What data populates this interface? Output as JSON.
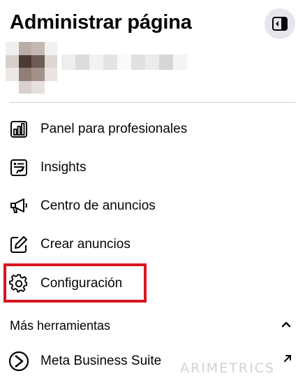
{
  "header": {
    "title": "Administrar página",
    "collapse_icon": "sidebar-collapse-icon"
  },
  "profile": {
    "avatar_blurred": true,
    "name_blurred": true
  },
  "menu": {
    "items": [
      {
        "label": "Panel para profesionales",
        "icon": "dashboard-chart-icon"
      },
      {
        "label": "Insights",
        "icon": "insights-report-icon"
      },
      {
        "label": "Centro de anuncios",
        "icon": "megaphone-icon"
      },
      {
        "label": "Crear anuncios",
        "icon": "edit-pencil-icon"
      },
      {
        "label": "Configuración",
        "icon": "gear-icon"
      }
    ]
  },
  "highlight": {
    "color": "#d8151f",
    "target": "Configuración"
  },
  "tools": {
    "label": "Más herramientas",
    "expanded": true,
    "items": [
      {
        "label": "Meta Business Suite",
        "icon": "meta-business-suite-icon",
        "external": true
      }
    ]
  },
  "watermark": {
    "text": "ARIMETRICS"
  },
  "colors": {
    "text": "#050505",
    "button_bg": "#e4e6eb",
    "divider": "#ced0d4",
    "highlight": "#d8151f"
  }
}
